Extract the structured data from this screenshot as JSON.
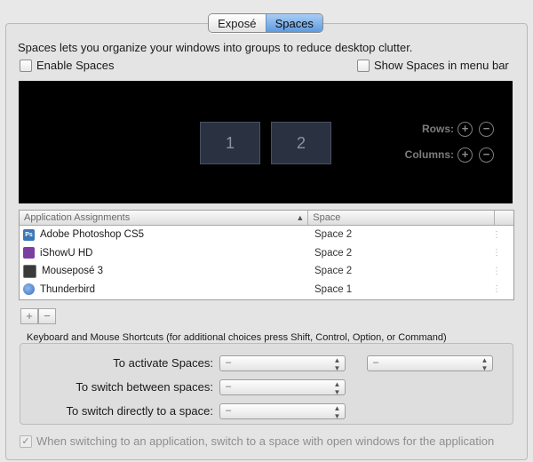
{
  "tabs": [
    {
      "label": "Exposé",
      "active": false
    },
    {
      "label": "Spaces",
      "active": true
    }
  ],
  "description": "Spaces lets you organize your windows into groups to reduce desktop clutter.",
  "enable_spaces": {
    "label": "Enable Spaces",
    "checked": false
  },
  "show_menu_bar": {
    "label": "Show Spaces in menu bar",
    "checked": false
  },
  "preview": {
    "spaces": [
      "1",
      "2"
    ],
    "rows_label": "Rows:",
    "columns_label": "Columns:",
    "plus": "+",
    "minus": "−"
  },
  "table": {
    "headers": [
      "Application Assignments",
      "Space"
    ],
    "sort_indicator": "▲",
    "rows": [
      {
        "app": "Adobe Photoshop CS5",
        "space": "Space 2",
        "icon": "photoshop-icon",
        "icon_text": "Ps",
        "icon_color": "#3a78b8"
      },
      {
        "app": "iShowU HD",
        "space": "Space 2",
        "icon": "ishowu-icon",
        "icon_text": "",
        "icon_color": "#7a3fa0"
      },
      {
        "app": "Mouseposé 3",
        "space": "Space 2",
        "icon": "mousepose-icon",
        "icon_text": "",
        "icon_color": "#3a3a3a"
      },
      {
        "app": "Thunderbird",
        "space": "Space 1",
        "icon": "thunderbird-icon",
        "icon_text": "",
        "icon_color": "#3d6fb6"
      }
    ],
    "row_stepper": "⋮"
  },
  "add_button": "+",
  "remove_button": "−",
  "shortcuts": {
    "title": "Keyboard and Mouse Shortcuts (for additional choices press Shift, Control, Option, or Command)",
    "activate_label": "To activate Spaces:",
    "switch_between_label": "To switch between spaces:",
    "switch_direct_label": "To switch directly to a space:",
    "popup_value": "–",
    "popup_arrows": "▲▼"
  },
  "switch_app": {
    "label": "When switching to an application, switch to a space with open windows for the application",
    "checked": true,
    "checkmark": "✓"
  },
  "colors": {
    "accent": "#5d9be0",
    "preview_bg": "#000000",
    "tile": "#2a3242"
  }
}
